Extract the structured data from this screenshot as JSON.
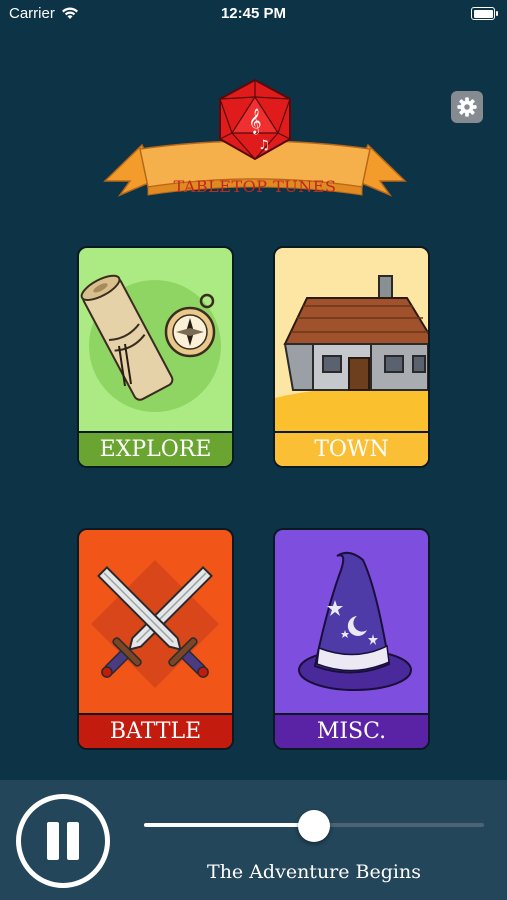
{
  "status_bar": {
    "carrier": "Carrier",
    "time": "12:45 PM",
    "battery_level": 1.0
  },
  "app": {
    "logo_text": "TABLETOP TUNES",
    "settings_icon": "gear-icon"
  },
  "categories": [
    {
      "label": "EXPLORE",
      "icon": "scroll-compass-icon",
      "bg": "#acea83",
      "band": "#6aa532"
    },
    {
      "label": "TOWN",
      "icon": "house-icon",
      "bg": "#fde5a4",
      "band": "#fbbf35"
    },
    {
      "label": "BATTLE",
      "icon": "crossed-swords-icon",
      "bg": "#f15518",
      "band": "#c41b0f"
    },
    {
      "label": "MISC.",
      "icon": "wizard-hat-icon",
      "bg": "#7e4ede",
      "band": "#5a23a6"
    }
  ],
  "player": {
    "state_icon": "pause-icon",
    "progress": 0.5,
    "track_title": "The Adventure Begins"
  },
  "colors": {
    "background": "#0d3346",
    "player_bar": "#23465a",
    "dice_red": "#e01b1b",
    "banner_orange": "#f5a63c"
  }
}
